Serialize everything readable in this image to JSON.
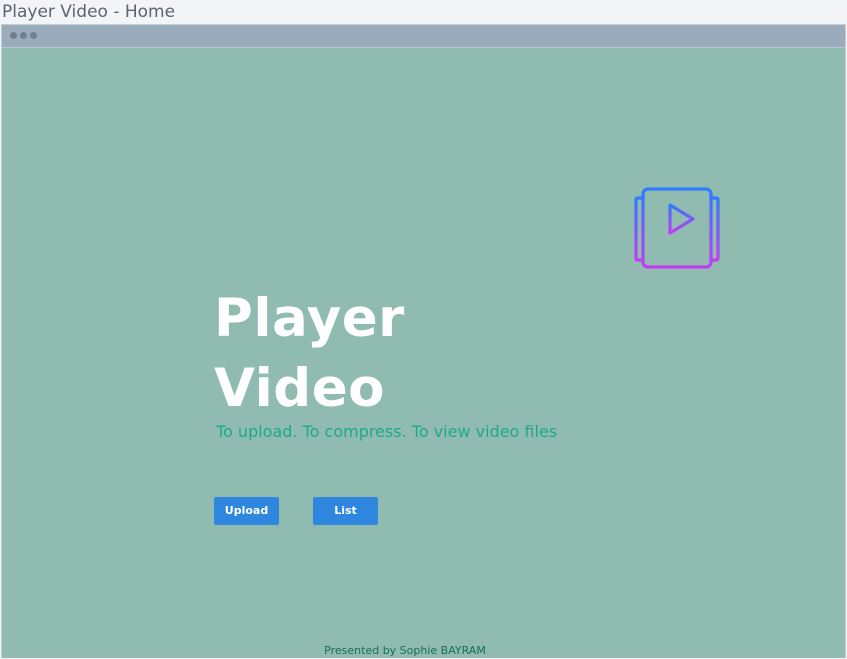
{
  "window": {
    "title": "Player Video - Home"
  },
  "hero": {
    "title_line1": "Player",
    "title_line2": "Video",
    "subtitle": "To upload. To compress. To view video files",
    "icon": "video-player-icon"
  },
  "actions": {
    "upload_label": "Upload",
    "list_label": "List"
  },
  "footer": {
    "text": "Presented by Sophie BAYRAM"
  },
  "colors": {
    "background": "#8fbbb1",
    "title": "#ffffff",
    "subtitle": "#1faa87",
    "button": "#2e86de",
    "footer_text": "#1a6f4d",
    "icon_gradient_start": "#2f7bff",
    "icon_gradient_end": "#c43cf2"
  }
}
